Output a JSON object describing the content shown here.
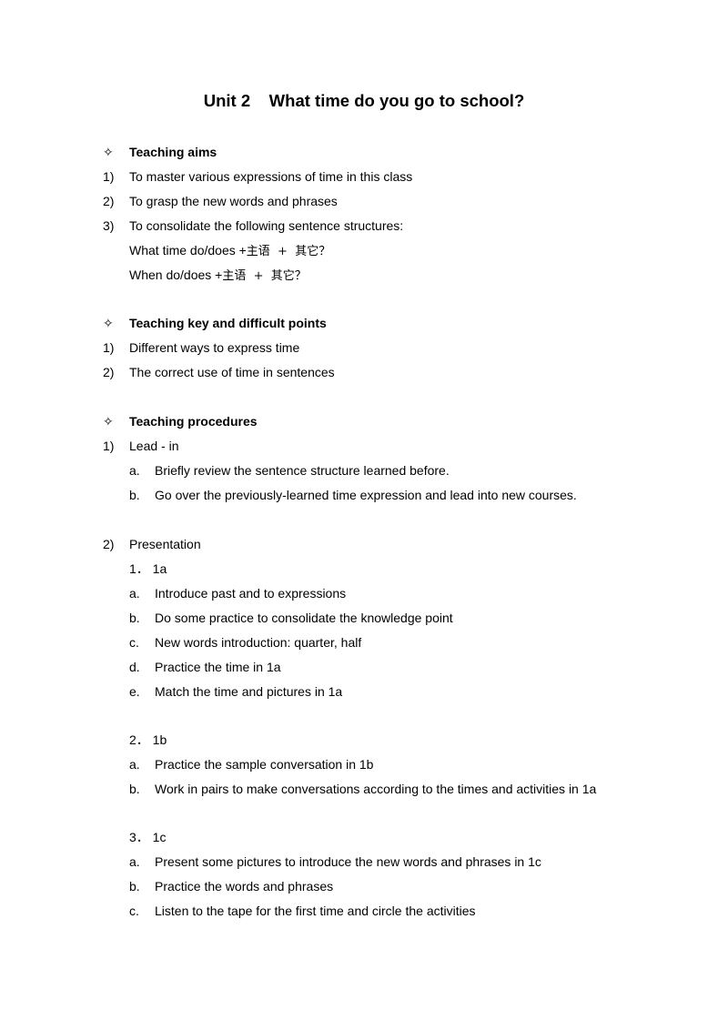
{
  "title": "Unit 2    What time do you go to school?",
  "bullet_glyph": "✧",
  "sections": {
    "aims": {
      "heading": "Teaching aims",
      "items": [
        {
          "marker": "1)",
          "text": "To master various expressions of time in this class"
        },
        {
          "marker": "2)",
          "text": "To grasp the new words and phrases"
        },
        {
          "marker": "3)",
          "text": "To consolidate the following sentence structures:"
        }
      ],
      "structures": [
        {
          "en": "What time do/does +",
          "cn": "主语  +  其它？"
        },
        {
          "en": "When do/does +",
          "cn": "主语  +  其它？"
        }
      ]
    },
    "key_points": {
      "heading": "Teaching key and difficult points",
      "items": [
        {
          "marker": "1)",
          "text": "Different ways to express time"
        },
        {
          "marker": "2)",
          "text": "The correct use of time in sentences"
        }
      ]
    },
    "procedures": {
      "heading": "Teaching procedures",
      "lead_in": {
        "marker": "1)",
        "text": "Lead - in",
        "items": [
          {
            "marker": "a.",
            "text": "Briefly review the sentence structure learned before."
          },
          {
            "marker": "b.",
            "text": "Go over the previously-learned time expression and lead into new courses."
          }
        ]
      },
      "presentation": {
        "marker": "2)",
        "text": "Presentation",
        "parts": [
          {
            "label": "1． 1a",
            "items": [
              {
                "marker": "a.",
                "text": "Introduce past and to expressions"
              },
              {
                "marker": "b.",
                "text": "Do some practice to consolidate the knowledge point"
              },
              {
                "marker": "c.",
                "text": "New words introduction: quarter, half"
              },
              {
                "marker": "d.",
                "text": "Practice the time in 1a"
              },
              {
                "marker": "e.",
                "text": "Match the time and pictures in 1a"
              }
            ]
          },
          {
            "label": "2． 1b",
            "items": [
              {
                "marker": "a.",
                "text": "Practice the sample conversation in 1b"
              },
              {
                "marker": "b.",
                "text": "Work in pairs to make conversations according to the times and activities in 1a"
              }
            ]
          },
          {
            "label": "3． 1c",
            "items": [
              {
                "marker": "a.",
                "text": "Present some pictures to introduce the new words and phrases in 1c"
              },
              {
                "marker": "b.",
                "text": "Practice the words and phrases"
              },
              {
                "marker": "c.",
                "text": "Listen to the tape for the first time and circle the activities"
              }
            ]
          }
        ]
      }
    }
  }
}
